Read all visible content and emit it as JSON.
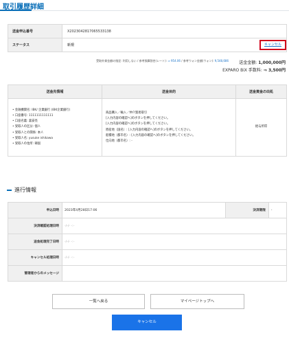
{
  "page": {
    "title": "取引履歴詳細"
  },
  "summary": {
    "id_label": "送金申込番号",
    "id_value": "X2023042817065533138",
    "status_label": "ステータス",
    "status_value": "新規",
    "cancel_link": "キャンセル"
  },
  "rates": {
    "prefix": "受取外貨金額の指定: 利用しない / 参考換算割合(レート):",
    "rate1": "⇒ 954.06",
    "middle": "/ 参考ウォン金額(ウォン):",
    "rate2": "9,548,686",
    "amount_label": "送金金額:",
    "amount_value": "1,000,000円",
    "fee_label": "EXPARO BiX 手数料:",
    "fee_value": "⇒ 3,500円"
  },
  "detail": {
    "headers": [
      "送金先情報",
      "送金目的",
      "送金資金の出処"
    ],
    "recipient": [
      "金融機関名: IBK/ 企業銀行 (IBK企業銀行)",
      "口座番号: 1111111111111",
      "口座名義: 喜安亮",
      "受取人の区分: 個人",
      "受取人との関係: 本人",
      "受取人名: yusuke ishikawa",
      "受取人の住所: 韓国"
    ],
    "purpose": [
      "商品購入／輸入／仲介貿易取引",
      "[入力内容の確認へ]のボタンを押してください。",
      "[入力内容の確認へ]のボタンを押してください。",
      "原産地（国名）: [入力内容の確認へ]のボタンを押してください。",
      "船積地（都市名）: [入力内容の確認へ]のボタンを押してください。",
      "仕向地（都市名）: -"
    ],
    "source": "給与所得"
  },
  "progress": {
    "section_title": "進行情報",
    "applied_label": "申込日時",
    "applied_value": "2023年4月28日17:06",
    "deadline_label": "決済期限",
    "deadline_value": "-",
    "confirm_label": "決済確認処理日時",
    "confirm_value": "-/-/- -:-",
    "sent_label": "送金処理完了日時",
    "sent_value": "-/-/- -:-",
    "cancel_label": "キャンセル処理日時",
    "cancel_value": "-/-/- -:-",
    "message_label": "管理者からのメッセージ",
    "message_value": ""
  },
  "buttons": {
    "back": "一覧へ戻る",
    "mypage": "マイページトップへ",
    "cancel": "キャンセル"
  },
  "colors": {
    "accent": "#0a6fb8",
    "primary_button": "#1a73e8",
    "highlight_border": "#d0021b"
  }
}
